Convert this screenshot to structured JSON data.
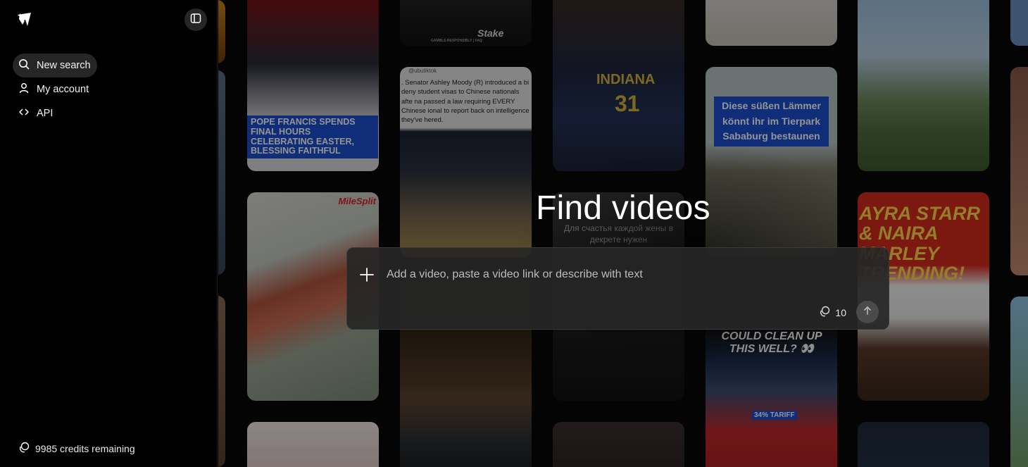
{
  "sidebar": {
    "logo_icon": "paper-plane-logo-icon",
    "toggle_icon": "sidebar-toggle-icon",
    "nav": [
      {
        "label": "New search",
        "icon": "search-icon",
        "active": true
      },
      {
        "label": "My account",
        "icon": "user-icon",
        "active": false
      },
      {
        "label": "API",
        "icon": "code-icon",
        "active": false
      }
    ],
    "credits_label": "9985 credits remaining",
    "credits_icon": "credits-icon"
  },
  "main": {
    "title": "Find videos",
    "search": {
      "placeholder": "Add a video, paste a video link or describe with text",
      "value": "",
      "add_icon": "plus-icon",
      "cost": "10",
      "cost_icon": "credits-icon",
      "submit_icon": "arrow-up-icon"
    }
  },
  "background_tiles": [
    {
      "caption": "POPE FRANCIS SPENDS FINAL HOURS CELEBRATING EASTER, BLESSING FAITHFUL"
    },
    {
      "caption": "Stake"
    },
    {
      "caption": "GAMBLE RESPONSIBLY | FAQ"
    },
    {
      "caption": ". Senator Ashley Moody (R) introduced a bi deny student visas to Chinese nationals afte na passed a law requiring EVERY Chinese ional to report back on intelligence they've hered."
    },
    {
      "caption": "@ubutiktok"
    },
    {
      "caption": "INDIANA"
    },
    {
      "caption": "31"
    },
    {
      "caption": "Diese süßen Lämmer könnt ihr im Tierpark Sababurg bestaunen"
    },
    {
      "caption": "MileSplit"
    },
    {
      "caption": "Для счастья каждой жены в декрете нужен"
    },
    {
      "caption": "AYRA STARR & NAIRA MARLEY TRENDING!"
    },
    {
      "caption": "COULD CLEAN UP THIS WELL? 👀"
    },
    {
      "caption": "34% TARIFF"
    }
  ],
  "colors": {
    "sidebar_bg": "#000000",
    "nav_active_bg": "#262626",
    "searchbox_bg": "#262626",
    "submit_bg": "#4a4a4a",
    "caption_blue": "#1a4fd1",
    "caption_red": "#e11d2a",
    "caption_green": "#3fdc4a"
  }
}
